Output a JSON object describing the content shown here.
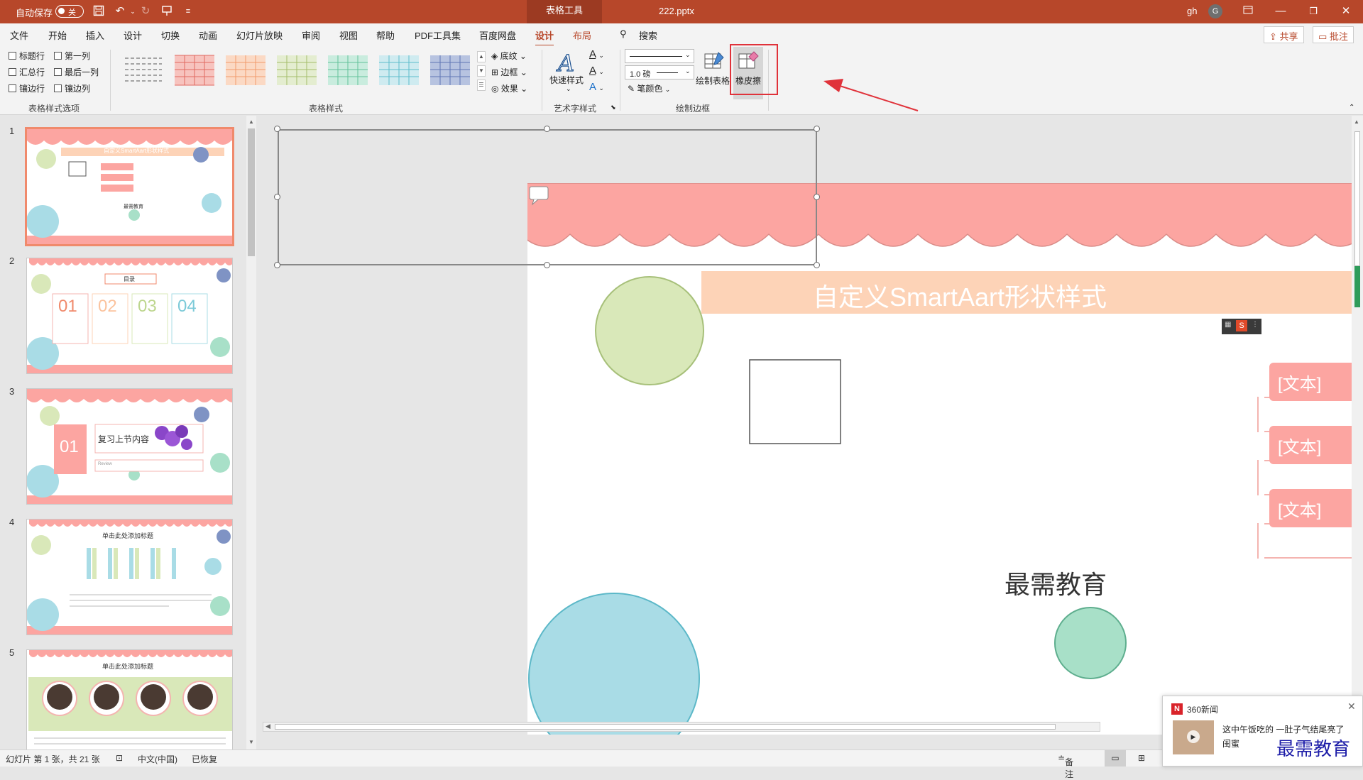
{
  "titlebar": {
    "autosave_label": "自动保存",
    "autosave_state": "关",
    "context_tab": "表格工具",
    "file_name": "222.pptx",
    "user": "gh",
    "avatar_letter": "G"
  },
  "menu": {
    "items": [
      "文件",
      "开始",
      "插入",
      "设计",
      "切换",
      "动画",
      "幻灯片放映",
      "审阅",
      "视图",
      "帮助",
      "PDF工具集",
      "百度网盘",
      "设计",
      "布局"
    ],
    "search": "搜索",
    "share": "共享",
    "comments": "批注"
  },
  "ribbon": {
    "options": {
      "header_row": "标题行",
      "first_column": "第一列",
      "total_row": "汇总行",
      "last_column": "最后一列",
      "banded_rows": "镶边行",
      "banded_columns": "镶边列",
      "label": "表格样式选项"
    },
    "styles_label": "表格样式",
    "shading": "底纹",
    "borders": "边框",
    "effects": "效果",
    "quick_styles": "快速样式",
    "wordart_label": "艺术字样式",
    "pen_weight": "1.0 磅",
    "pen_color": "笔颜色",
    "draw_table": "绘制表格",
    "eraser": "橡皮擦",
    "draw_borders_label": "绘制边框"
  },
  "thumbnails": [
    {
      "num": "1",
      "title": "自定义SmartAart形状样式",
      "sub": "最需教育"
    },
    {
      "num": "2",
      "title": "目录",
      "items": [
        "01",
        "02",
        "03",
        "04"
      ]
    },
    {
      "num": "3",
      "big": "01",
      "title": "复习上节内容",
      "sub": "Review"
    },
    {
      "num": "4",
      "title": "单击此处添加标题"
    },
    {
      "num": "5",
      "title": "单击此处添加标题"
    }
  ],
  "slide": {
    "title": "自定义SmartAart形状样式",
    "placeholders": [
      "[文本]",
      "[文本]",
      "[文本]"
    ],
    "footer_text": "最需教育"
  },
  "status": {
    "slide_info": "幻灯片 第 1 张，共 21 张",
    "language": "中文(中国)",
    "recovered": "已恢复",
    "notes": "备注"
  },
  "news": {
    "source": "360新闻",
    "headline": "这中午饭吃的 一肚子气结尾亮了",
    "sub": "闺蜜",
    "watermark": "最需教育"
  },
  "colors": {
    "accent": "#b7472a",
    "salmon": "#fca5a1",
    "peach": "#fdd3b7",
    "green_circle": "#d9e8b9",
    "blue_circle": "#a9dce6",
    "teal_circle": "#a8e0c8"
  }
}
